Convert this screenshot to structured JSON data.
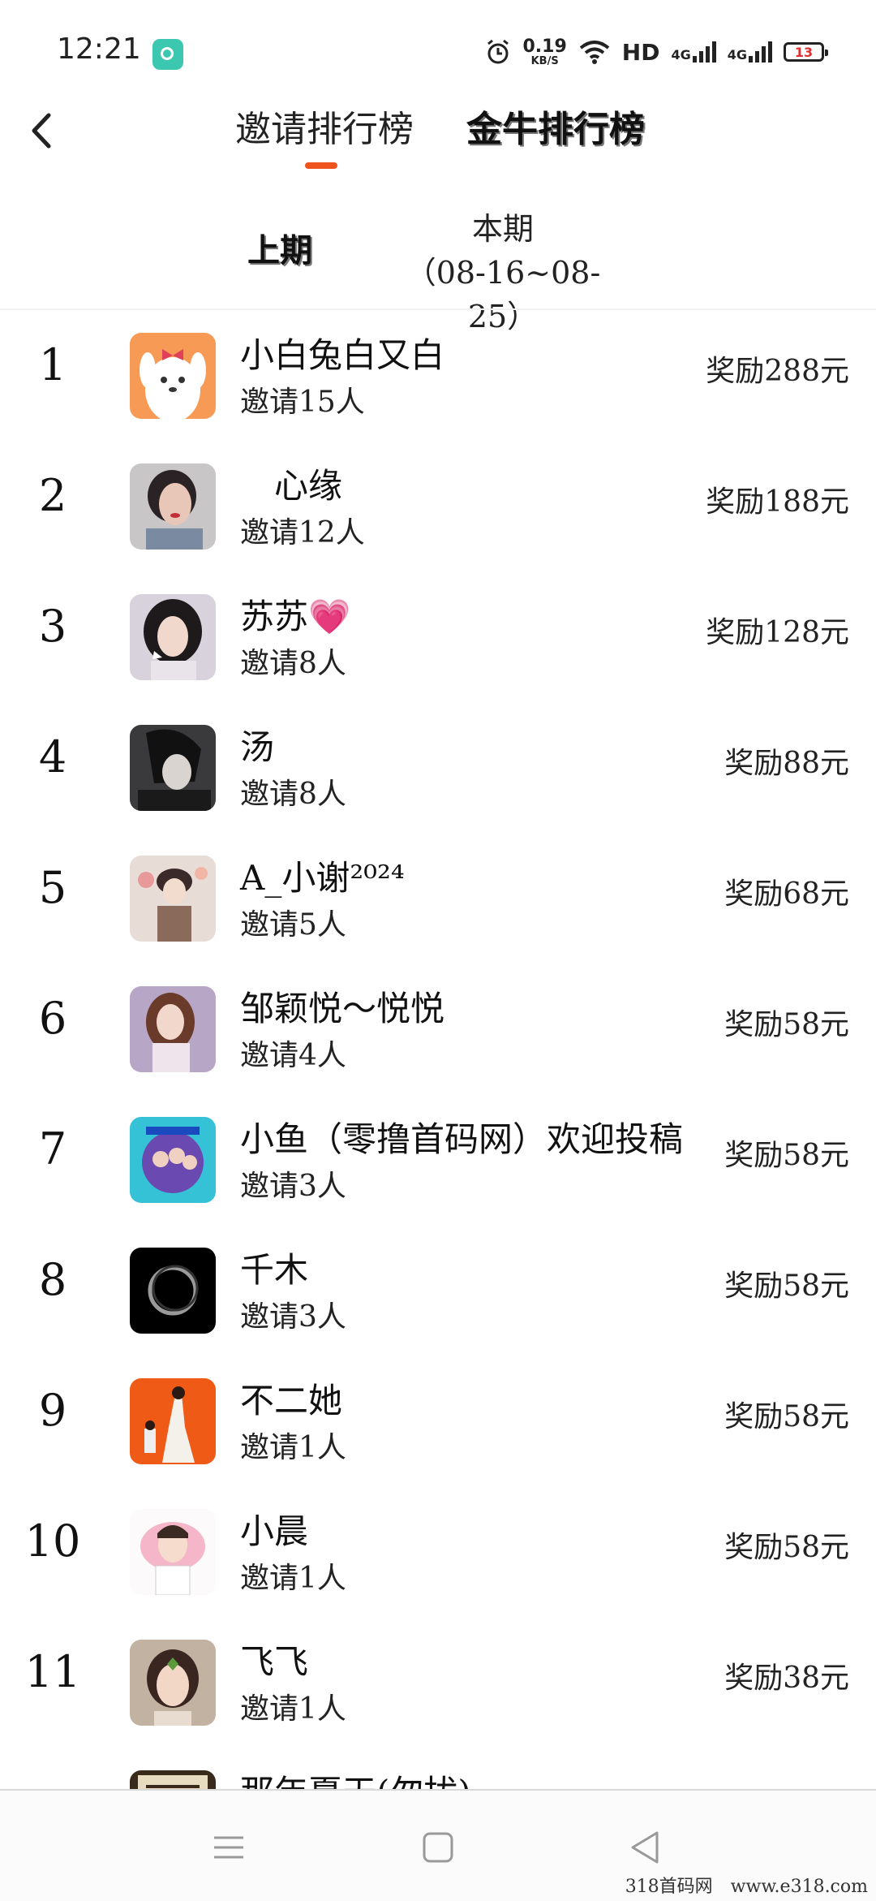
{
  "status_bar": {
    "time": "12:21",
    "net_speed": "0.19",
    "net_unit": "KB/S",
    "hd": "HD",
    "sim1": "4G",
    "sim2": "4G",
    "battery": "13"
  },
  "header": {
    "tabs": [
      {
        "label": "邀请排行榜",
        "active": true
      },
      {
        "label": "金牛排行榜",
        "active": false
      }
    ]
  },
  "period": {
    "prev_label": "上期",
    "current_label": "本期",
    "current_range": "（08-16~08-25）"
  },
  "ranking": [
    {
      "rank": "1",
      "name": "小白兔白又白",
      "invites": "邀请15人",
      "reward": "奖励288元",
      "avatar": "cartoon-puppy"
    },
    {
      "rank": "2",
      "name": "　心缘",
      "invites": "邀请12人",
      "reward": "奖励188元",
      "avatar": "woman-selfie"
    },
    {
      "rank": "3",
      "name": "苏苏💗",
      "invites": "邀请8人",
      "reward": "奖励128元",
      "avatar": "woman-portrait"
    },
    {
      "rank": "4",
      "name": "汤",
      "invites": "邀请8人",
      "reward": "奖励88元",
      "avatar": "anime-boy-dark"
    },
    {
      "rank": "5",
      "name": "A_小谢²⁰²⁴",
      "invites": "邀请5人",
      "reward": "奖励68元",
      "avatar": "anime-couple"
    },
    {
      "rank": "6",
      "name": "邹颖悦～悦悦",
      "invites": "邀请4人",
      "reward": "奖励58元",
      "avatar": "woman-purple"
    },
    {
      "rank": "7",
      "name": "小鱼（零撸首码网）欢迎投稿",
      "invites": "邀请3人",
      "reward": "奖励58元",
      "avatar": "group-photo-cyan"
    },
    {
      "rank": "8",
      "name": "千木",
      "invites": "邀请3人",
      "reward": "奖励58元",
      "avatar": "black-ring"
    },
    {
      "rank": "9",
      "name": "不二她",
      "invites": "邀请1人",
      "reward": "奖励58元",
      "avatar": "couple-orange"
    },
    {
      "rank": "10",
      "name": "小晨",
      "invites": "邀请1人",
      "reward": "奖励58元",
      "avatar": "cartoon-boy-pink"
    },
    {
      "rank": "11",
      "name": "飞飞",
      "invites": "邀请1人",
      "reward": "奖励38元",
      "avatar": "girl-filter"
    },
    {
      "rank": "",
      "name": "那年夏天(勿扰)",
      "invites": "",
      "reward": "",
      "avatar": "calligraphy"
    }
  ],
  "nav": {
    "buttons": [
      "menu-icon",
      "home-icon",
      "back-triangle-icon"
    ]
  },
  "watermark": "318首码网　www.e318.com",
  "colors": {
    "accent": "#f0541e",
    "text": "#222222"
  }
}
